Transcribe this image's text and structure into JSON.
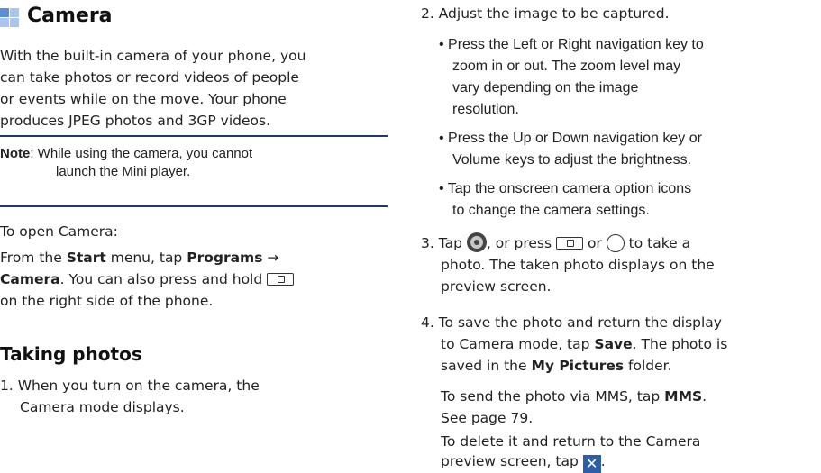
{
  "left": {
    "title": "Camera",
    "intro": [
      "With the built-in camera of your phone, you",
      "can take photos or record videos of people",
      "or events while on the move. Your phone",
      "produces JPEG photos and 3GP videos."
    ],
    "note_label": "Note",
    "note_line1": ": While using the camera, you cannot",
    "note_line2": "launch the Mini player.",
    "open_title": "To open Camera:",
    "open_1_pre": "From the ",
    "open_1_start": "Start",
    "open_1_mid": " menu, tap ",
    "open_1_programs": "Programs",
    "open_1_arrow": " →",
    "open_2_camera": "Camera",
    "open_2_rest": ". You can also press and hold ",
    "open_3": "on the right side of the phone.",
    "section_title": "Taking photos",
    "step1_line1": "1. When you turn on the camera, the",
    "step1_line2": "Camera mode displays."
  },
  "right": {
    "step2": "2. Adjust the image to be captured.",
    "bullet1": [
      "• Press the Left or Right navigation key to",
      "zoom in or out. The zoom level may",
      "vary depending on the image",
      "resolution."
    ],
    "bullet2": [
      "• Press the Up or Down navigation key or",
      "Volume keys to adjust the brightness."
    ],
    "bullet3": [
      "• Tap the onscreen camera option icons",
      "to change the camera settings."
    ],
    "step3_a": "3. Tap ",
    "step3_b": ", or press ",
    "step3_c": " or ",
    "step3_d": " to take a",
    "step3_line2": "photo. The taken photo displays on the",
    "step3_line3": "preview screen.",
    "step4_line1": "4. To save the photo and return the display",
    "step4_line2_pre": "to Camera mode, tap ",
    "step4_save": "Save",
    "step4_line2_post": ". The photo is",
    "step4_line3_pre": "saved in the ",
    "step4_mypictures": "My Pictures",
    "step4_line3_post": " folder.",
    "mms_pre": "To send the photo via MMS, tap ",
    "mms_bold": "MMS",
    "mms_post": ".",
    "mms_page": "See page 79.",
    "delete_line1": "To delete it and return to the Camera",
    "delete_line2_pre": "preview screen, tap ",
    "delete_line2_post": "."
  },
  "icons": {
    "title_icon": "blue-squares-icon",
    "camera_key": "camera-key-icon",
    "shutter": "shutter-button-icon",
    "circle_key": "confirm-key-icon",
    "delete": "delete-x-icon"
  },
  "colors": {
    "rule": "#1f3a6a",
    "icon_blue_dark": "#5b8fd6",
    "icon_blue_light": "#a9c6ee",
    "delete_icon": "#2d5fa6"
  }
}
